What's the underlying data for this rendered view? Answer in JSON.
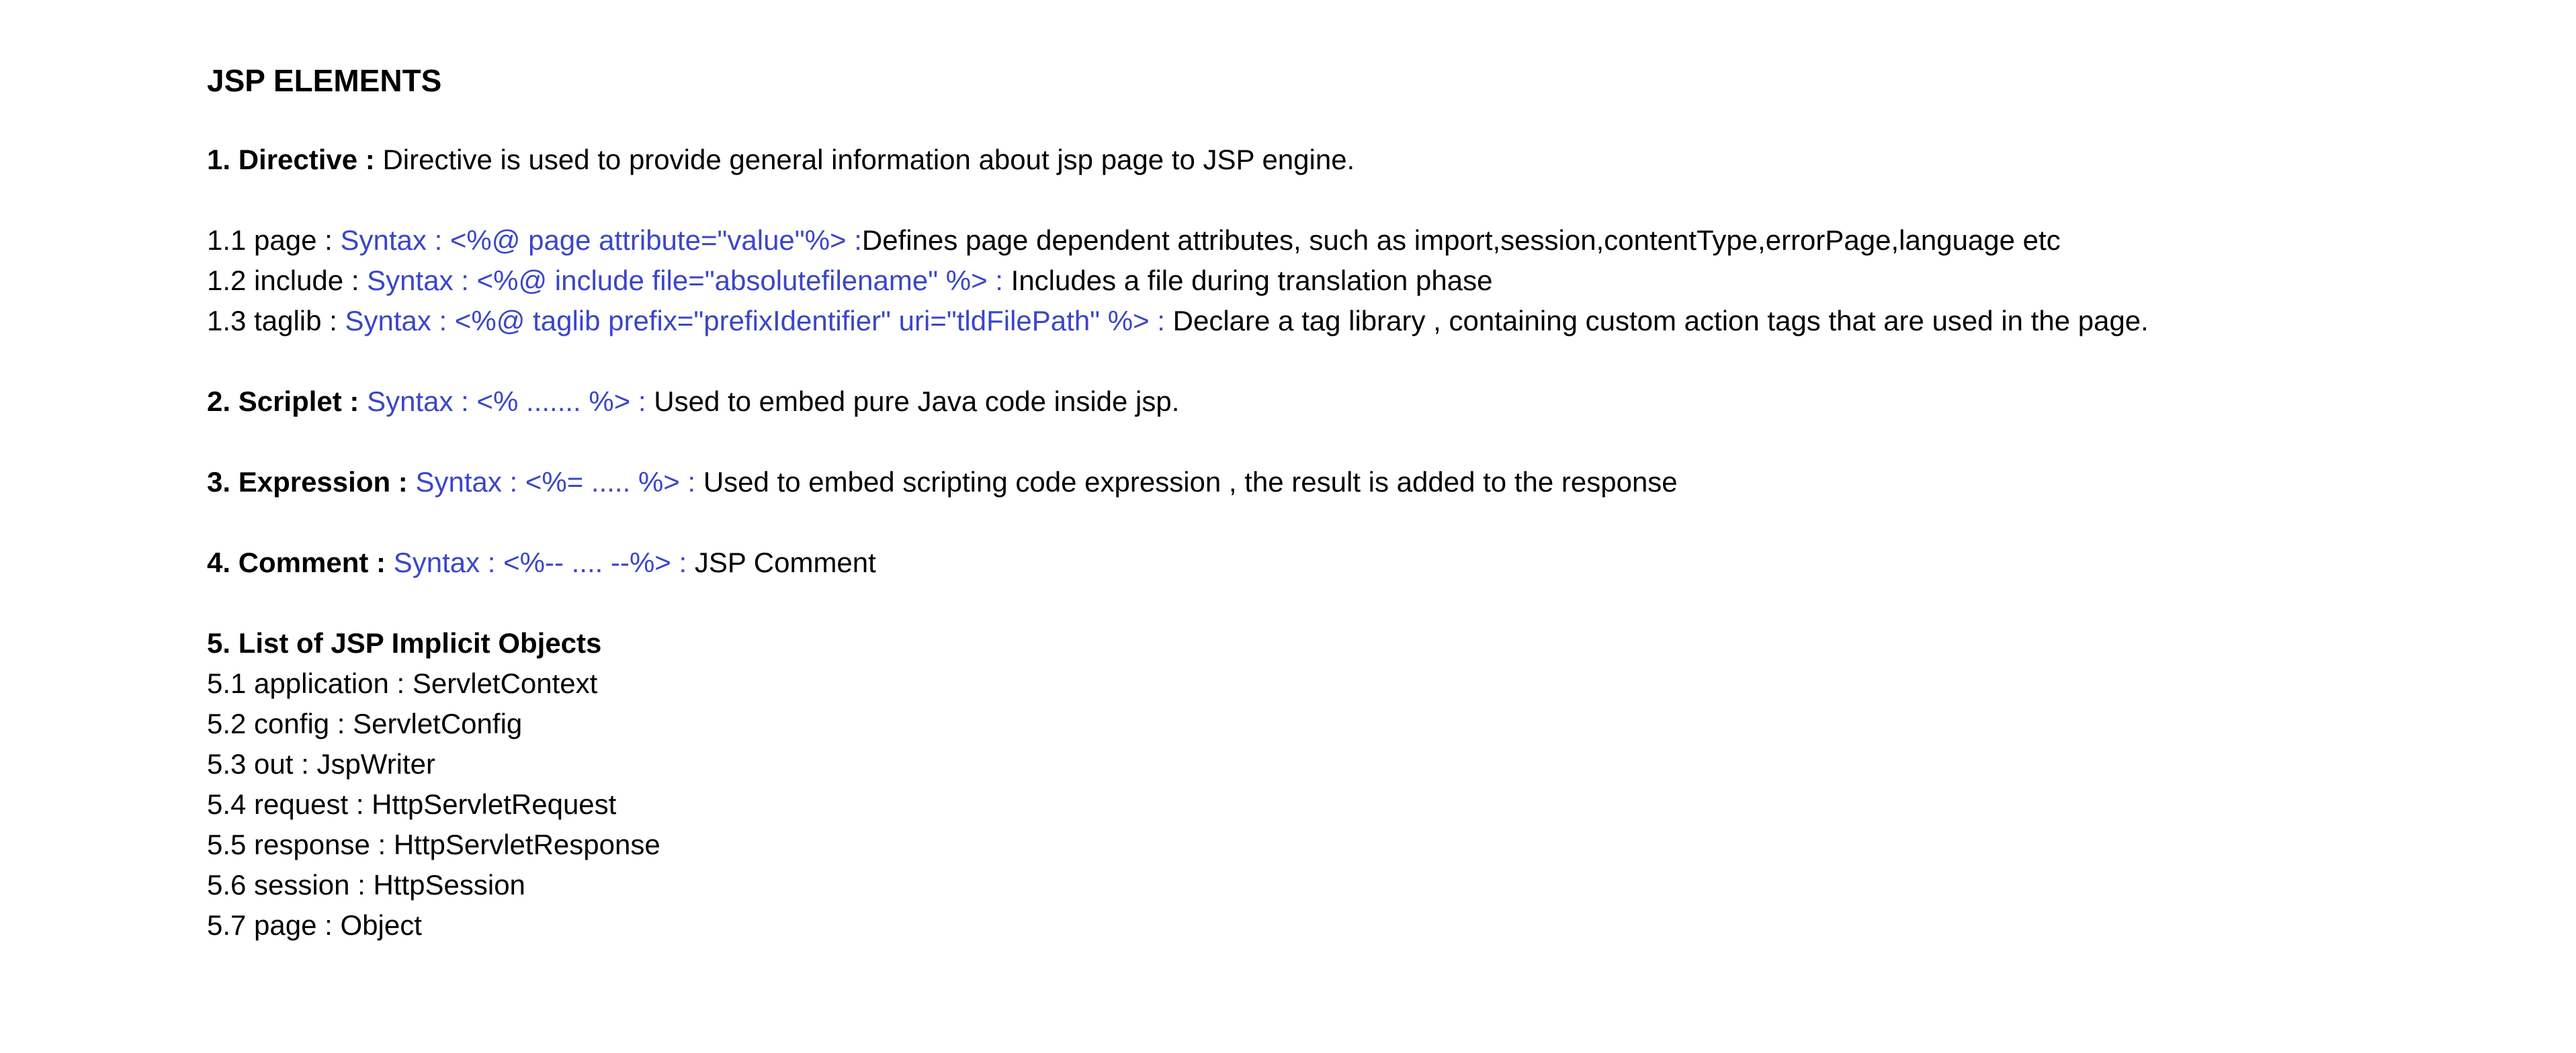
{
  "doc": {
    "title": "JSP ELEMENTS",
    "accent_color": "#3a46c8",
    "directive": {
      "heading": "1. Directive :",
      "text": " Directive is used to provide general information about jsp page to JSP engine."
    },
    "directives": [
      {
        "label": "1.1 page : ",
        "syntax": "Syntax : <%@ page attribute=\"value\"%>  :",
        "text": "Defines page dependent attributes, such as import,session,contentType,errorPage,language etc"
      },
      {
        "label": "1.2 include : ",
        "syntax": "Syntax : <%@ include file=\"absolutefilename\" %> :",
        "text": " Includes a file during translation phase"
      },
      {
        "label": "1.3 taglib : ",
        "syntax": "Syntax : <%@ taglib prefix=\"prefixIdentifier\" uri=\"tldFilePath\" %> :",
        "text": " Declare a tag library , containing custom action tags that are used in the page."
      }
    ],
    "scriptlet": {
      "heading": "2. Scriplet :",
      "syntax": " Syntax : <% ....... %>  :",
      "text": " Used to embed pure Java code inside jsp."
    },
    "expression": {
      "heading": "3. Expression :",
      "syntax": " Syntax : <%= ..... %> :",
      "text": " Used to embed scripting code expression , the result is added to the response"
    },
    "comment": {
      "heading": "4. Comment :",
      "syntax": " Syntax : <%-- .... --%> :",
      "text": " JSP Comment"
    },
    "implicit_objects": {
      "heading": "5. List of JSP Implicit Objects",
      "items": [
        "5.1 application : ServletContext",
        "5.2 config : ServletConfig",
        "5.3 out : JspWriter",
        "5.4 request : HttpServletRequest",
        "5.5 response : HttpServletResponse",
        "5.6 session : HttpSession",
        "5.7 page : Object"
      ]
    }
  }
}
